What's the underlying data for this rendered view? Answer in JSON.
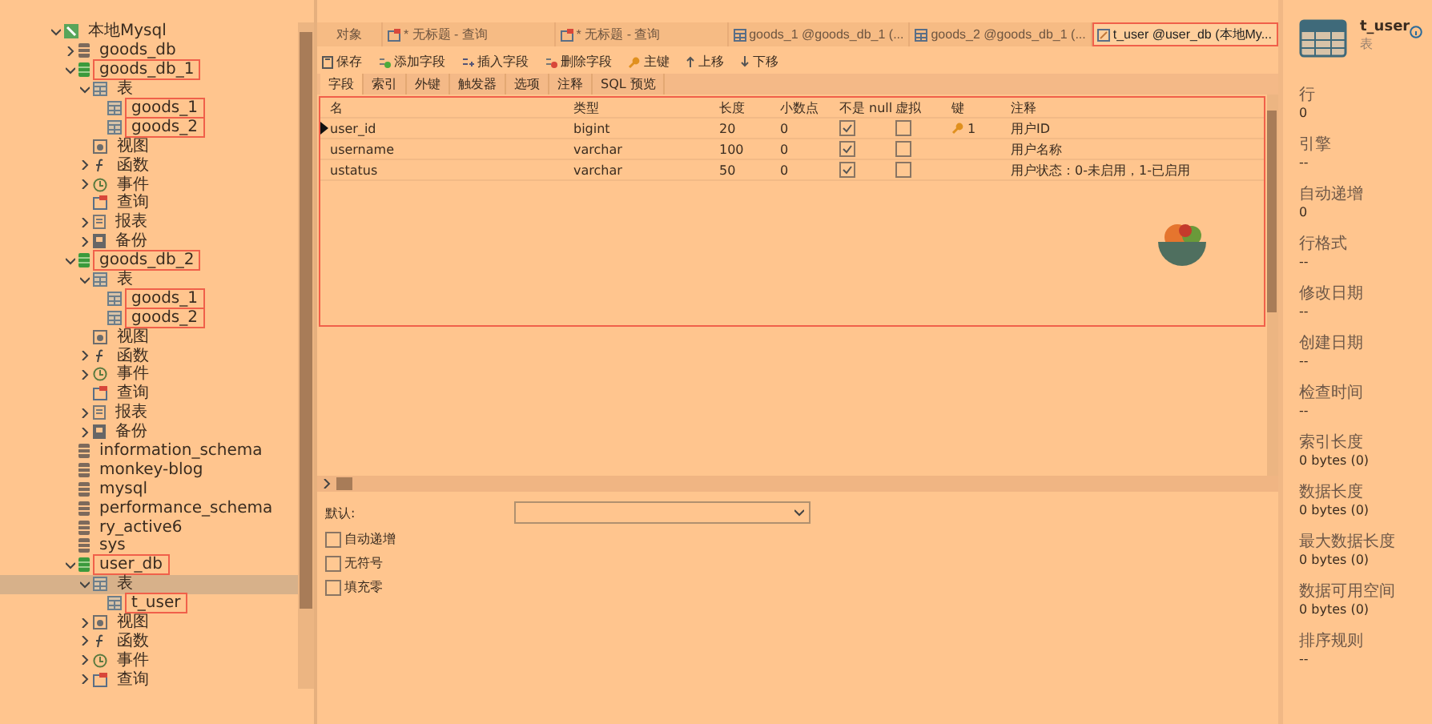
{
  "tree": [
    {
      "label": "本地Mysql",
      "kind": "connection",
      "expanded": true,
      "selected": false,
      "highlighted": false,
      "children": [
        {
          "label": "goods_db",
          "kind": "database",
          "expanded": false,
          "selected": false,
          "highlighted": false
        },
        {
          "label": "goods_db_1",
          "kind": "database-open",
          "expanded": true,
          "selected": false,
          "highlighted": true,
          "children": [
            {
              "label": "表",
              "kind": "tables",
              "expanded": true,
              "selected": false,
              "highlighted": false,
              "children": [
                {
                  "label": "goods_1",
                  "kind": "table",
                  "selected": false,
                  "highlighted": true
                },
                {
                  "label": "goods_2",
                  "kind": "table",
                  "selected": false,
                  "highlighted": true
                }
              ]
            },
            {
              "label": "视图",
              "kind": "views",
              "selected": false,
              "highlighted": false
            },
            {
              "label": "函数",
              "kind": "functions",
              "expanded": false,
              "selected": false,
              "highlighted": false
            },
            {
              "label": "事件",
              "kind": "events",
              "expanded": false,
              "selected": false,
              "highlighted": false
            },
            {
              "label": "查询",
              "kind": "queries",
              "selected": false,
              "highlighted": false
            },
            {
              "label": "报表",
              "kind": "reports",
              "expanded": false,
              "selected": false,
              "highlighted": false
            },
            {
              "label": "备份",
              "kind": "backups",
              "expanded": false,
              "selected": false,
              "highlighted": false
            }
          ]
        },
        {
          "label": "goods_db_2",
          "kind": "database-open",
          "expanded": true,
          "selected": false,
          "highlighted": true,
          "children": [
            {
              "label": "表",
              "kind": "tables",
              "expanded": true,
              "selected": false,
              "highlighted": false,
              "children": [
                {
                  "label": "goods_1",
                  "kind": "table",
                  "selected": false,
                  "highlighted": true
                },
                {
                  "label": "goods_2",
                  "kind": "table",
                  "selected": false,
                  "highlighted": true
                }
              ]
            },
            {
              "label": "视图",
              "kind": "views",
              "selected": false,
              "highlighted": false
            },
            {
              "label": "函数",
              "kind": "functions",
              "expanded": false,
              "selected": false,
              "highlighted": false
            },
            {
              "label": "事件",
              "kind": "events",
              "expanded": false,
              "selected": false,
              "highlighted": false
            },
            {
              "label": "查询",
              "kind": "queries",
              "selected": false,
              "highlighted": false
            },
            {
              "label": "报表",
              "kind": "reports",
              "expanded": false,
              "selected": false,
              "highlighted": false
            },
            {
              "label": "备份",
              "kind": "backups",
              "expanded": false,
              "selected": false,
              "highlighted": false
            }
          ]
        },
        {
          "label": "information_schema",
          "kind": "database",
          "selected": false,
          "highlighted": false
        },
        {
          "label": "monkey-blog",
          "kind": "database",
          "selected": false,
          "highlighted": false
        },
        {
          "label": "mysql",
          "kind": "database",
          "selected": false,
          "highlighted": false
        },
        {
          "label": "performance_schema",
          "kind": "database",
          "selected": false,
          "highlighted": false
        },
        {
          "label": "ry_active6",
          "kind": "database",
          "selected": false,
          "highlighted": false
        },
        {
          "label": "sys",
          "kind": "database",
          "selected": false,
          "highlighted": false
        },
        {
          "label": "user_db",
          "kind": "database-open",
          "expanded": true,
          "selected": false,
          "highlighted": true,
          "children": [
            {
              "label": "表",
              "kind": "tables",
              "expanded": true,
              "selected": true,
              "highlighted": false,
              "children": [
                {
                  "label": "t_user",
                  "kind": "table",
                  "selected": false,
                  "highlighted": true
                }
              ]
            },
            {
              "label": "视图",
              "kind": "views",
              "expanded": false,
              "selected": false,
              "highlighted": false
            },
            {
              "label": "函数",
              "kind": "functions",
              "expanded": false,
              "selected": false,
              "highlighted": false
            },
            {
              "label": "事件",
              "kind": "events",
              "expanded": false,
              "selected": false,
              "highlighted": false
            },
            {
              "label": "查询",
              "kind": "queries",
              "expanded": false,
              "selected": false,
              "highlighted": false
            }
          ]
        }
      ]
    }
  ],
  "tabs": [
    {
      "label": "对象",
      "kind": "objects",
      "selected": false,
      "highlighted": false
    },
    {
      "label": "* 无标题 - 查询",
      "kind": "query",
      "selected": false,
      "highlighted": false
    },
    {
      "label": "* 无标题 - 查询",
      "kind": "query",
      "selected": false,
      "highlighted": false
    },
    {
      "label": "goods_1 @goods_db_1 (...",
      "kind": "table",
      "selected": false,
      "highlighted": false
    },
    {
      "label": "goods_2 @goods_db_1 (...",
      "kind": "table",
      "selected": false,
      "highlighted": false
    },
    {
      "label": "t_user @user_db (本地My...",
      "kind": "design",
      "selected": true,
      "highlighted": true
    }
  ],
  "toolbar": [
    {
      "label": "保存",
      "kind": "save"
    },
    {
      "label": "添加字段",
      "kind": "add"
    },
    {
      "label": "插入字段",
      "kind": "insert"
    },
    {
      "label": "删除字段",
      "kind": "delete"
    },
    {
      "label": "主键",
      "kind": "key"
    },
    {
      "label": "上移",
      "kind": "up"
    },
    {
      "label": "下移",
      "kind": "down"
    }
  ],
  "subtabs": [
    {
      "label": "字段",
      "selected": true
    },
    {
      "label": "索引",
      "selected": false
    },
    {
      "label": "外键",
      "selected": false
    },
    {
      "label": "触发器",
      "selected": false
    },
    {
      "label": "选项",
      "selected": false
    },
    {
      "label": "注释",
      "selected": false
    },
    {
      "label": "SQL 预览",
      "selected": false
    }
  ],
  "columns": [
    "名",
    "类型",
    "长度",
    "小数点",
    "不是 null",
    "虚拟",
    "键",
    "注释"
  ],
  "fields": [
    {
      "name": "user_id",
      "type": "bigint",
      "length": "20",
      "decimals": "0",
      "not_null": true,
      "virtual": false,
      "key": "1",
      "comment": "用户ID",
      "current": true
    },
    {
      "name": "username",
      "type": "varchar",
      "length": "100",
      "decimals": "0",
      "not_null": true,
      "virtual": false,
      "comment": "用户名称",
      "current": false
    },
    {
      "name": "ustatus",
      "type": "varchar",
      "length": "50",
      "decimals": "0",
      "not_null": true,
      "virtual": false,
      "comment": "用户状态：0-未启用，1-已启用",
      "current": false
    }
  ],
  "grid_highlighted": true,
  "properties": {
    "default_label": "默认:",
    "options": [
      {
        "label": "自动递增",
        "checked": false
      },
      {
        "label": "无符号",
        "checked": false
      },
      {
        "label": "填充零",
        "checked": false
      }
    ]
  },
  "info": {
    "name": "t_user",
    "type": "表",
    "items": [
      {
        "label": "行",
        "value": "0"
      },
      {
        "label": "引擎",
        "value": "--"
      },
      {
        "label": "自动递增",
        "value": "0"
      },
      {
        "label": "行格式",
        "value": "--"
      },
      {
        "label": "修改日期",
        "value": "--"
      },
      {
        "label": "创建日期",
        "value": "--"
      },
      {
        "label": "检查时间",
        "value": "--"
      },
      {
        "label": "索引长度",
        "value": "0 bytes (0)"
      },
      {
        "label": "数据长度",
        "value": "0 bytes (0)"
      },
      {
        "label": "最大数据长度",
        "value": "0 bytes (0)"
      },
      {
        "label": "数据可用空间",
        "value": "0 bytes (0)"
      },
      {
        "label": "排序规则",
        "value": "--"
      }
    ]
  }
}
